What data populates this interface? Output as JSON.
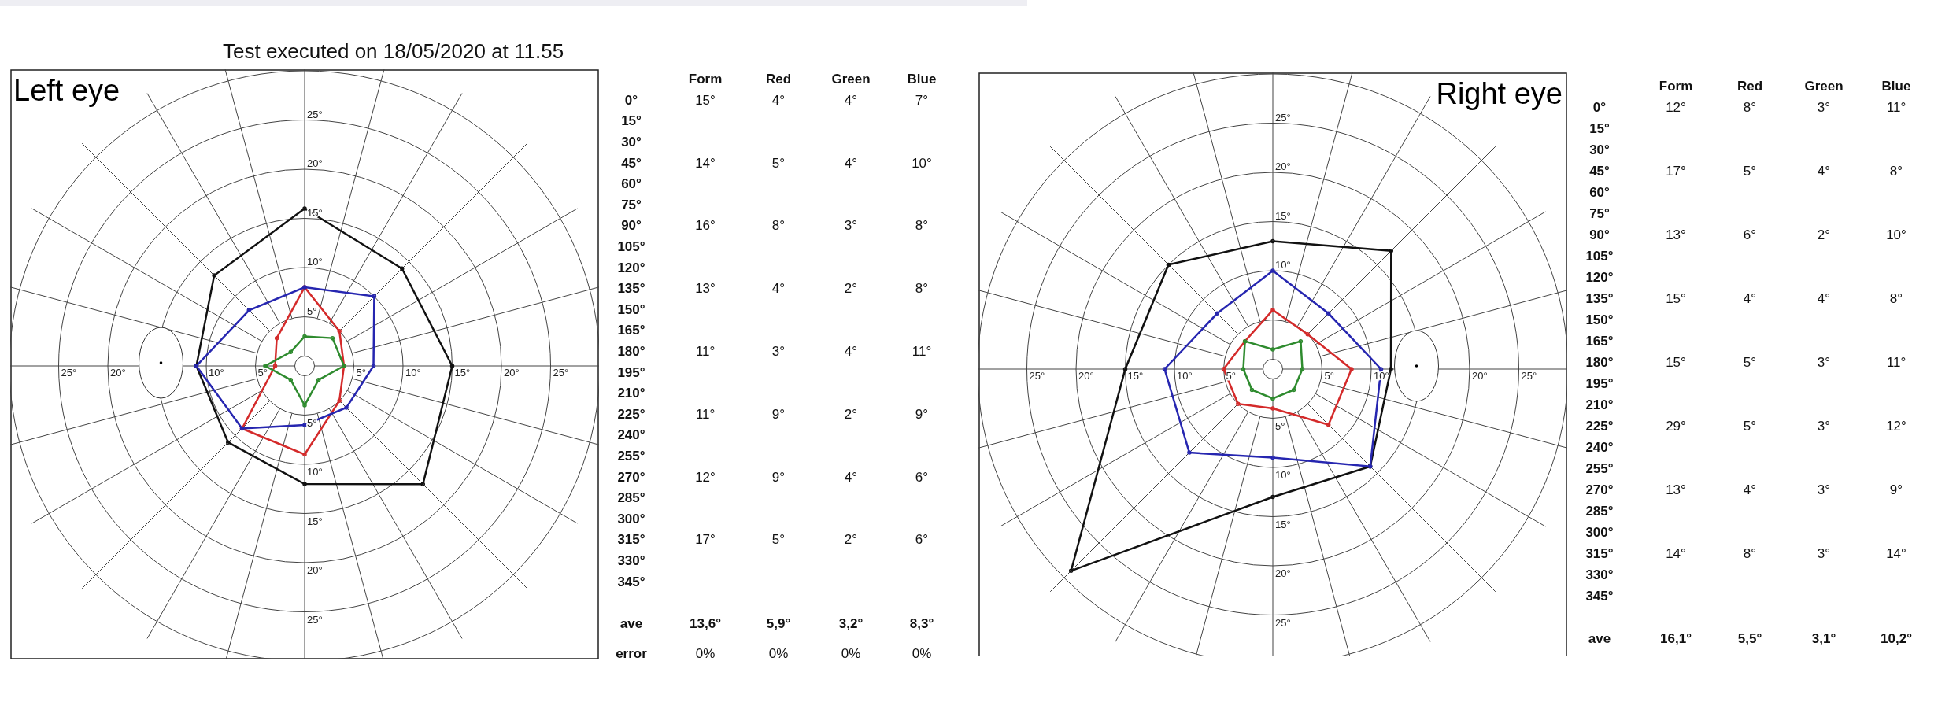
{
  "title": "Test executed on 18/05/2020 at 11.55",
  "eyes": [
    {
      "label": "Left eye",
      "kind": "left_eye",
      "axis_labels": {
        "up": [
          "25°",
          "20°",
          "15°",
          "10°",
          "5°"
        ],
        "down": [
          "5°",
          "10°",
          "15°",
          "20°",
          "25°"
        ],
        "left": [
          "25°",
          "20°",
          "10°",
          "5°"
        ],
        "right": [
          "5°",
          "10°",
          "15°",
          "20°",
          "25°"
        ]
      },
      "columns": [
        {
          "label": "Form",
          "color": "#111111"
        },
        {
          "label": "Red",
          "color": "#d42a2a"
        },
        {
          "label": "Green",
          "color": "#2e8b2e"
        },
        {
          "label": "Blue",
          "color": "#2626b0"
        }
      ],
      "rows": [
        {
          "angle": "0°",
          "values": [
            "15°",
            "4°",
            "4°",
            "7°"
          ]
        },
        {
          "angle": "15°"
        },
        {
          "angle": "30°"
        },
        {
          "angle": "45°",
          "values": [
            "14°",
            "5°",
            "4°",
            "10°"
          ]
        },
        {
          "angle": "60°"
        },
        {
          "angle": "75°"
        },
        {
          "angle": "90°",
          "values": [
            "16°",
            "8°",
            "3°",
            "8°"
          ]
        },
        {
          "angle": "105°"
        },
        {
          "angle": "120°"
        },
        {
          "angle": "135°",
          "values": [
            "13°",
            "4°",
            "2°",
            "8°"
          ]
        },
        {
          "angle": "150°"
        },
        {
          "angle": "165°"
        },
        {
          "angle": "180°",
          "values": [
            "11°",
            "3°",
            "4°",
            "11°"
          ]
        },
        {
          "angle": "195°"
        },
        {
          "angle": "210°"
        },
        {
          "angle": "225°",
          "values": [
            "11°",
            "9°",
            "2°",
            "9°"
          ]
        },
        {
          "angle": "240°"
        },
        {
          "angle": "255°"
        },
        {
          "angle": "270°",
          "values": [
            "12°",
            "9°",
            "4°",
            "6°"
          ]
        },
        {
          "angle": "285°"
        },
        {
          "angle": "300°"
        },
        {
          "angle": "315°",
          "values": [
            "17°",
            "5°",
            "2°",
            "6°"
          ]
        },
        {
          "angle": "330°"
        },
        {
          "angle": "345°"
        }
      ],
      "summary": [
        {
          "label": "ave",
          "kind": "average",
          "values": [
            "13,6°",
            "5,9°",
            "3,2°",
            "8,3°"
          ]
        },
        {
          "label": "error",
          "kind": "error",
          "values": [
            "0%",
            "0%",
            "0%",
            "0%"
          ]
        }
      ]
    },
    {
      "label": "Right eye",
      "kind": "right_eye",
      "axis_labels": {
        "up": [
          "25°",
          "20°",
          "15°",
          "10°"
        ],
        "down": [
          "5°",
          "10°",
          "15°",
          "20°",
          "25°"
        ],
        "left": [
          "25°",
          "20°",
          "15°",
          "10°",
          "5°"
        ],
        "right": [
          "5°",
          "10°",
          "20°",
          "25°"
        ]
      },
      "columns": [
        {
          "label": "Form",
          "color": "#111111"
        },
        {
          "label": "Red",
          "color": "#d42a2a"
        },
        {
          "label": "Green",
          "color": "#2e8b2e"
        },
        {
          "label": "Blue",
          "color": "#2626b0"
        }
      ],
      "rows": [
        {
          "angle": "0°",
          "values": [
            "12°",
            "8°",
            "3°",
            "11°"
          ]
        },
        {
          "angle": "15°"
        },
        {
          "angle": "30°"
        },
        {
          "angle": "45°",
          "values": [
            "17°",
            "5°",
            "4°",
            "8°"
          ]
        },
        {
          "angle": "60°"
        },
        {
          "angle": "75°"
        },
        {
          "angle": "90°",
          "values": [
            "13°",
            "6°",
            "2°",
            "10°"
          ]
        },
        {
          "angle": "105°"
        },
        {
          "angle": "120°"
        },
        {
          "angle": "135°",
          "values": [
            "15°",
            "4°",
            "4°",
            "8°"
          ]
        },
        {
          "angle": "150°"
        },
        {
          "angle": "165°"
        },
        {
          "angle": "180°",
          "values": [
            "15°",
            "5°",
            "3°",
            "11°"
          ]
        },
        {
          "angle": "195°"
        },
        {
          "angle": "210°"
        },
        {
          "angle": "225°",
          "values": [
            "29°",
            "5°",
            "3°",
            "12°"
          ]
        },
        {
          "angle": "240°"
        },
        {
          "angle": "255°"
        },
        {
          "angle": "270°",
          "values": [
            "13°",
            "4°",
            "3°",
            "9°"
          ]
        },
        {
          "angle": "285°"
        },
        {
          "angle": "300°"
        },
        {
          "angle": "315°",
          "values": [
            "14°",
            "8°",
            "3°",
            "14°"
          ]
        },
        {
          "angle": "330°"
        },
        {
          "angle": "345°"
        }
      ],
      "summary": [
        {
          "label": "ave",
          "kind": "average",
          "values": [
            "16,1°",
            "5,5°",
            "3,1°",
            "10,2°"
          ]
        }
      ]
    }
  ]
}
